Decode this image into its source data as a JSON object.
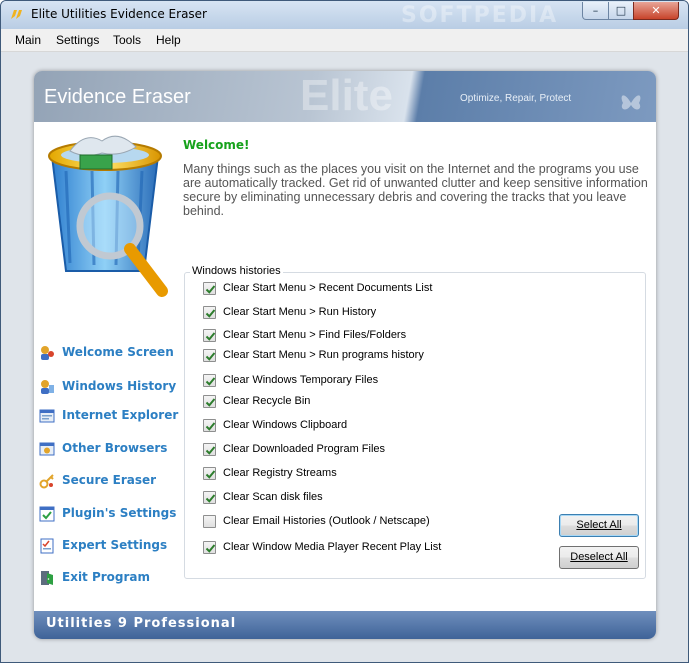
{
  "window": {
    "title": "Elite Utilities Evidence Eraser",
    "watermark": "SOFTPEDIA",
    "controls": {
      "minimize": "–",
      "maximize": "□",
      "close": "✕"
    }
  },
  "menu": [
    "Main",
    "Settings",
    "Tools",
    "Help"
  ],
  "header": {
    "title": "Evidence Eraser",
    "brand_watermark": "Elite",
    "slogan": "Optimize, Repair, Protect"
  },
  "sidebar": {
    "items": [
      {
        "label": "Welcome Screen",
        "icon": "welcome-icon"
      },
      {
        "label": "Windows History",
        "icon": "windows-history-icon"
      },
      {
        "label": "Internet Explorer",
        "icon": "internet-explorer-icon"
      },
      {
        "label": "Other Browsers",
        "icon": "other-browsers-icon"
      },
      {
        "label": "Secure Eraser",
        "icon": "secure-eraser-icon"
      },
      {
        "label": "Plugin's Settings",
        "icon": "plugin-settings-icon"
      },
      {
        "label": "Expert Settings",
        "icon": "expert-settings-icon"
      },
      {
        "label": "Exit Program",
        "icon": "exit-icon"
      }
    ]
  },
  "content": {
    "heading": "Welcome!",
    "intro": "Many things such as the places you visit on the Internet and the programs you use are automatically tracked. Get rid of unwanted clutter and keep sensitive information secure by eliminating unnecessary debris and covering the tracks that you leave behind.",
    "group_title": "Windows histories",
    "options": [
      {
        "label": "Clear Start Menu > Recent Documents List",
        "checked": true
      },
      {
        "label": "Clear Start Menu > Run History",
        "checked": true
      },
      {
        "label": "Clear Start Menu > Find Files/Folders",
        "checked": true
      },
      {
        "label": "Clear Start Menu > Run programs history",
        "checked": true
      },
      {
        "label": "Clear Windows Temporary Files",
        "checked": true
      },
      {
        "label": "Clear Recycle Bin",
        "checked": true
      },
      {
        "label": "Clear Windows Clipboard",
        "checked": true
      },
      {
        "label": "Clear Downloaded Program Files",
        "checked": true
      },
      {
        "label": "Clear Registry Streams",
        "checked": true
      },
      {
        "label": "Clear Scan disk files",
        "checked": true
      },
      {
        "label": "Clear Email Histories (Outlook / Netscape)",
        "checked": false
      },
      {
        "label": "Clear Window Media Player Recent Play List",
        "checked": true
      }
    ],
    "select_all": "Select All",
    "deselect_all": "Deselect All"
  },
  "footer": {
    "text": "Utilities 9 Professional"
  },
  "colors": {
    "link_blue": "#2c7fc3",
    "welcome_green": "#16a21b",
    "footer_blue": "#3f6398"
  }
}
